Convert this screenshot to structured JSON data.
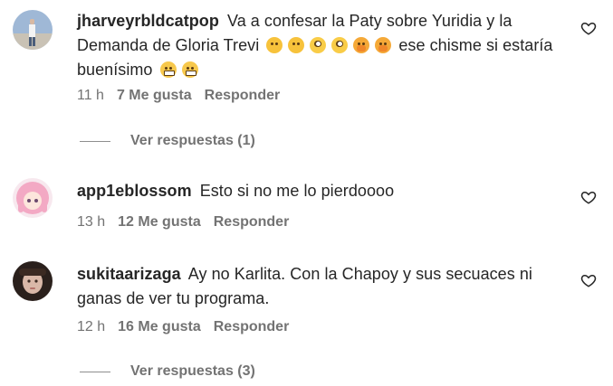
{
  "comments": [
    {
      "username": "jharveyrbldcatpop",
      "text_parts": [
        "Va a confesar la Paty sobre Yuridia y la Demanda de Gloria Trevi",
        "ese chisme si estaría buenísimo"
      ],
      "emojis_1": [
        "thinking-face-emoji",
        "thinking-face-emoji",
        "face-with-rolling-eyes-emoji",
        "face-with-rolling-eyes-emoji",
        "face-with-hand-over-mouth-emoji",
        "face-with-hand-over-mouth-emoji"
      ],
      "emojis_2": [
        "grimacing-face-emoji",
        "grimacing-face-emoji"
      ],
      "time": "11 h",
      "likes": "7 Me gusta",
      "reply_label": "Responder",
      "view_replies": "Ver respuestas (1)"
    },
    {
      "username": "app1eblossom",
      "text": "Esto si no me lo pierdoooo",
      "time": "13 h",
      "likes": "12 Me gusta",
      "reply_label": "Responder"
    },
    {
      "username": "sukitaarizaga",
      "text": "Ay no Karlita. Con la Chapoy y sus secuaces ni ganas de ver tu programa.",
      "time": "12 h",
      "likes": "16 Me gusta",
      "reply_label": "Responder",
      "view_replies": "Ver respuestas (3)"
    }
  ],
  "colors": {
    "text": "#262626",
    "secondary": "#737373",
    "background": "#ffffff"
  },
  "icons": {
    "like": "heart-outline-icon"
  }
}
